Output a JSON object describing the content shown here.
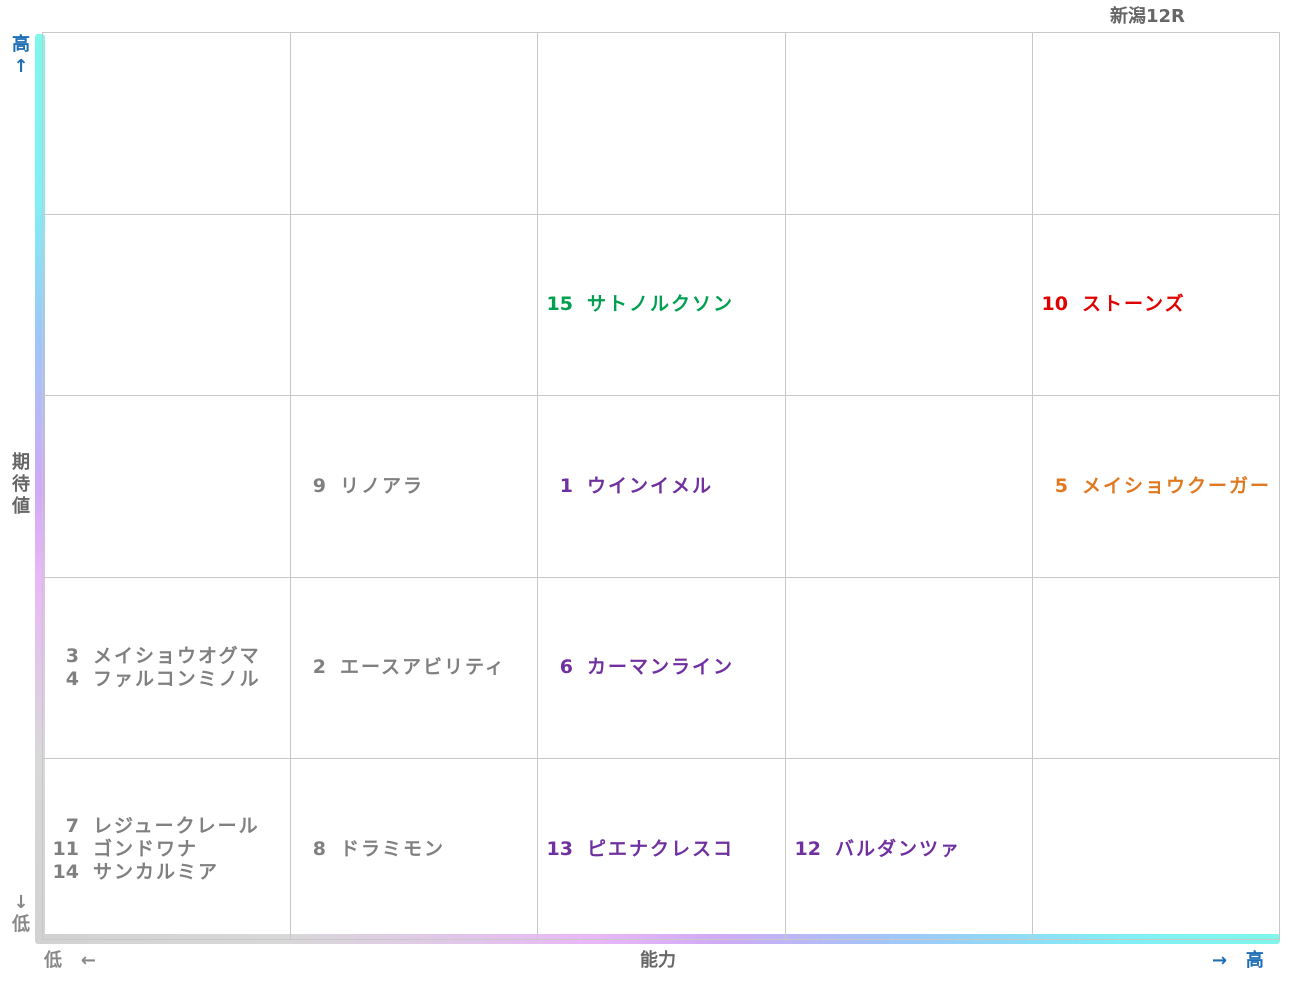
{
  "race_title": "新潟12R",
  "axes": {
    "y_label": "期待値",
    "y_high": "高",
    "y_low": "低",
    "x_label": "能力",
    "x_high": "高",
    "x_low": "低",
    "arrow_up": "↑",
    "arrow_down": "↓",
    "arrow_left": "←",
    "arrow_right": "→"
  },
  "colors": {
    "gray": "#808080",
    "purple": "#7030a0",
    "green": "#00a050",
    "red": "#e00000",
    "orange": "#e07820",
    "axis_high": "#1f6fb5"
  },
  "chart_data": {
    "type": "table",
    "title": "新潟12R",
    "xlabel": "能力",
    "ylabel": "期待値",
    "columns": 5,
    "rows": 5,
    "cells": [
      {
        "col": 2,
        "row": 1,
        "color": "green",
        "horses": [
          {
            "num": "15",
            "name": "サトノルクソン"
          }
        ]
      },
      {
        "col": 4,
        "row": 1,
        "color": "red",
        "horses": [
          {
            "num": "10",
            "name": "ストーンズ"
          }
        ]
      },
      {
        "col": 1,
        "row": 2,
        "color": "gray",
        "horses": [
          {
            "num": "9",
            "name": "リノアラ"
          }
        ]
      },
      {
        "col": 2,
        "row": 2,
        "color": "purple",
        "horses": [
          {
            "num": "1",
            "name": "ウインイメル"
          }
        ]
      },
      {
        "col": 4,
        "row": 2,
        "color": "orange",
        "horses": [
          {
            "num": "5",
            "name": "メイショウクーガー"
          }
        ]
      },
      {
        "col": 0,
        "row": 3,
        "color": "gray",
        "horses": [
          {
            "num": "3",
            "name": "メイショウオグマ"
          },
          {
            "num": "4",
            "name": "ファルコンミノル"
          }
        ]
      },
      {
        "col": 1,
        "row": 3,
        "color": "gray",
        "horses": [
          {
            "num": "2",
            "name": "エースアビリティ"
          }
        ]
      },
      {
        "col": 2,
        "row": 3,
        "color": "purple",
        "horses": [
          {
            "num": "6",
            "name": "カーマンライン"
          }
        ]
      },
      {
        "col": 0,
        "row": 4,
        "color": "gray",
        "horses": [
          {
            "num": "7",
            "name": "レジュークレール"
          },
          {
            "num": "11",
            "name": "ゴンドワナ"
          },
          {
            "num": "14",
            "name": "サンカルミア"
          }
        ]
      },
      {
        "col": 1,
        "row": 4,
        "color": "gray",
        "horses": [
          {
            "num": "8",
            "name": "ドラミモン"
          }
        ]
      },
      {
        "col": 2,
        "row": 4,
        "color": "purple",
        "horses": [
          {
            "num": "13",
            "name": "ピエナクレスコ"
          }
        ]
      },
      {
        "col": 3,
        "row": 4,
        "color": "purple",
        "horses": [
          {
            "num": "12",
            "name": "バルダンツァ"
          }
        ]
      }
    ]
  }
}
